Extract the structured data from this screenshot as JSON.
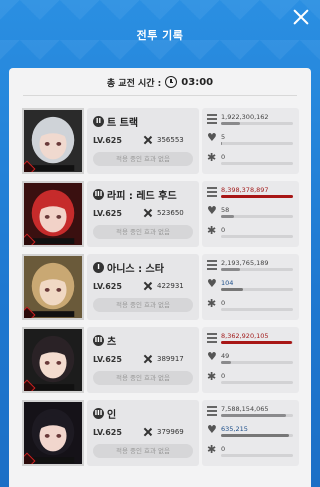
{
  "header": {
    "title": "전투 기록"
  },
  "summary": {
    "label": "총 교전 시간 :",
    "time": "03:00"
  },
  "cards": [
    {
      "burst": "II",
      "name": "트 트랙",
      "level": "LV.625",
      "power": "356553",
      "effect": "적용 중인 효과 없음",
      "portrait": {
        "hair": "#cfd3d8",
        "face": "#f0d9cf",
        "bg": "#2a2a2a"
      },
      "stats": [
        {
          "icon": "damage-icon",
          "value": "1,922,300,162",
          "fill": 0.26,
          "style": ""
        },
        {
          "icon": "heal-icon",
          "value": "5",
          "fill": 0.02,
          "style": ""
        },
        {
          "icon": "star-icon",
          "value": "0",
          "fill": 0.0,
          "style": ""
        }
      ]
    },
    {
      "burst": "III",
      "name": "라피 : 레드 후드",
      "level": "LV.625",
      "power": "523650",
      "effect": "적용 중인 효과 없음",
      "portrait": {
        "hair": "#c62b2b",
        "face": "#f2d2c8",
        "bg": "#3a1010"
      },
      "stats": [
        {
          "icon": "damage-icon",
          "value": "8,398,378,897",
          "fill": 1.0,
          "style": "red"
        },
        {
          "icon": "heal-icon",
          "value": "58",
          "fill": 0.18,
          "style": ""
        },
        {
          "icon": "star-icon",
          "value": "0",
          "fill": 0.0,
          "style": ""
        }
      ]
    },
    {
      "burst": "I",
      "name": "아니스 : 스타",
      "level": "LV.625",
      "power": "422931",
      "effect": "적용 중인 효과 없음",
      "portrait": {
        "hair": "#c9a873",
        "face": "#f0d8c4",
        "bg": "#6a5a3a"
      },
      "stats": [
        {
          "icon": "damage-icon",
          "value": "2,193,765,189",
          "fill": 0.26,
          "style": ""
        },
        {
          "icon": "heal-icon",
          "value": "104",
          "fill": 0.3,
          "style": "blue"
        },
        {
          "icon": "star-icon",
          "value": "0",
          "fill": 0.0,
          "style": ""
        }
      ]
    },
    {
      "burst": "III",
      "name": "츠",
      "level": "LV.625",
      "power": "389917",
      "effect": "적용 중인 효과 없음",
      "portrait": {
        "hair": "#2a2226",
        "face": "#f3dccf",
        "bg": "#1c1c1c"
      },
      "stats": [
        {
          "icon": "damage-icon",
          "value": "8,362,920,105",
          "fill": 0.99,
          "style": "red"
        },
        {
          "icon": "heal-icon",
          "value": "49",
          "fill": 0.14,
          "style": ""
        },
        {
          "icon": "star-icon",
          "value": "0",
          "fill": 0.0,
          "style": ""
        }
      ]
    },
    {
      "burst": "III",
      "name": "인",
      "level": "LV.625",
      "power": "379969",
      "effect": "적용 중인 효과 없음",
      "portrait": {
        "hair": "#1d1a22",
        "face": "#f1d6cd",
        "bg": "#151218"
      },
      "stats": [
        {
          "icon": "damage-icon",
          "value": "7,588,154,065",
          "fill": 0.9,
          "style": ""
        },
        {
          "icon": "heal-icon",
          "value": "635,215",
          "fill": 0.95,
          "style": "blue"
        },
        {
          "icon": "star-icon",
          "value": "0",
          "fill": 0.0,
          "style": ""
        }
      ]
    }
  ]
}
